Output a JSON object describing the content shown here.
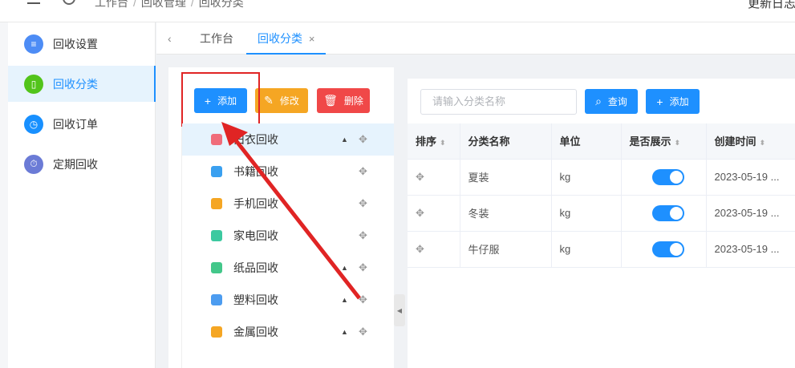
{
  "header": {
    "breadcrumb": [
      "工作台",
      "回收管理",
      "回收分类"
    ],
    "right_text": "更新日志"
  },
  "sidebar": {
    "items": [
      {
        "label": "回收设置",
        "color": "#4d8cf5",
        "glyph": "≡"
      },
      {
        "label": "回收分类",
        "color": "#52c41a",
        "glyph": "▯"
      },
      {
        "label": "回收订单",
        "color": "#1890ff",
        "glyph": "◷"
      },
      {
        "label": "定期回收",
        "color": "#6b7bd6",
        "glyph": "⏱"
      }
    ]
  },
  "tabs": {
    "back": "‹",
    "items": [
      "工作台",
      "回收分类"
    ],
    "close": "×"
  },
  "toolbar": {
    "add": "添加",
    "edit": "修改",
    "delete": "删除",
    "add_color": "#1e90ff",
    "edit_color": "#f5a623",
    "delete_color": "#f04848"
  },
  "tree": [
    {
      "label": "旧衣回收",
      "icon_color": "#f06c7a",
      "up": "▲",
      "move": "✥"
    },
    {
      "label": "书籍回收",
      "icon_color": "#3aa0f0",
      "up": "",
      "move": "✥"
    },
    {
      "label": "手机回收",
      "icon_color": "#f5a623",
      "up": "",
      "move": "✥"
    },
    {
      "label": "家电回收",
      "icon_color": "#3cc9a0",
      "up": "",
      "move": "✥"
    },
    {
      "label": "纸品回收",
      "icon_color": "#43c78a",
      "up": "▲",
      "move": "✥"
    },
    {
      "label": "塑料回收",
      "icon_color": "#4c9cf0",
      "up": "▲",
      "move": "✥"
    },
    {
      "label": "金属回收",
      "icon_color": "#f5a623",
      "up": "▲",
      "move": "✥"
    }
  ],
  "collapse_glyph": "◀",
  "search": {
    "placeholder": "请输入分类名称",
    "query": "查询",
    "add": "添加"
  },
  "table": {
    "headers": [
      "排序",
      "分类名称",
      "单位",
      "是否展示",
      "创建时间"
    ],
    "sort_glyph": "⬍",
    "rows": [
      {
        "move": "✥",
        "name": "夏装",
        "unit": "kg",
        "show": true,
        "created": "2023-05-19 ..."
      },
      {
        "move": "✥",
        "name": "冬装",
        "unit": "kg",
        "show": true,
        "created": "2023-05-19 ..."
      },
      {
        "move": "✥",
        "name": "牛仔服",
        "unit": "kg",
        "show": true,
        "created": "2023-05-19 ..."
      }
    ]
  },
  "annotation": {
    "color": "#e02424"
  }
}
